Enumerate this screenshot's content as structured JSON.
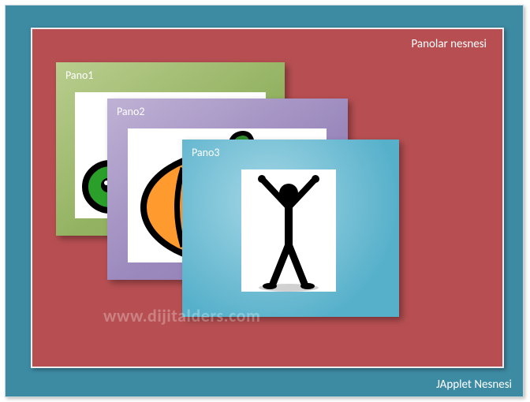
{
  "outer_label": "JApplet Nesnesi",
  "inner_label": "Panolar nesnesi",
  "watermark": "www.dijitalders.com",
  "panels": {
    "p1": {
      "title": "Pano1"
    },
    "p2": {
      "title": "Pano2"
    },
    "p3": {
      "title": "Pano3"
    }
  }
}
